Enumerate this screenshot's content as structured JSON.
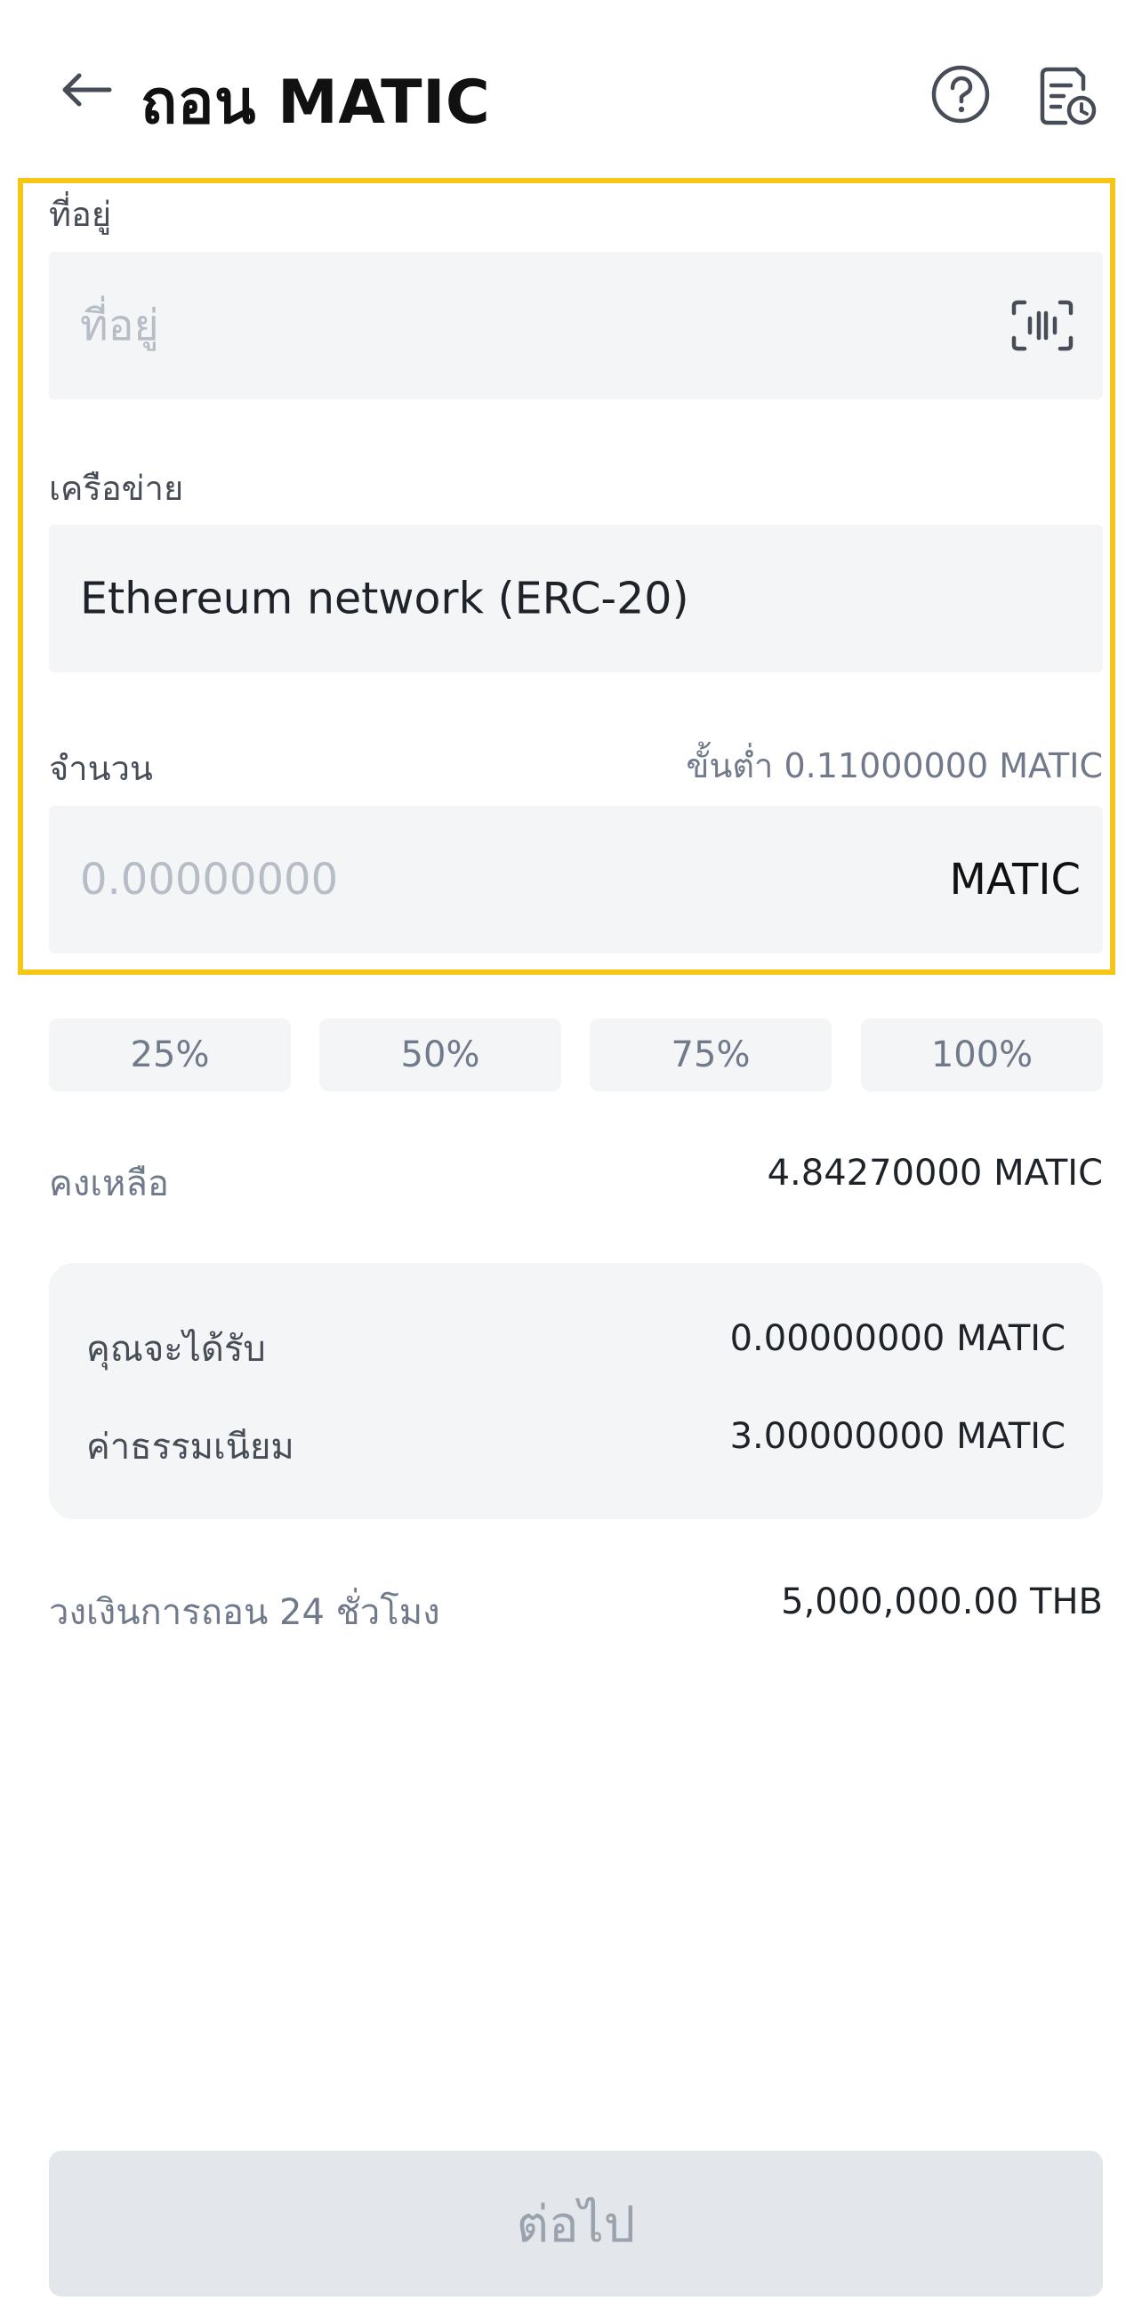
{
  "header": {
    "title": "ถอน MATIC",
    "back_icon": "arrow-left-icon",
    "help_icon": "question-circle-icon",
    "history_icon": "document-clock-icon"
  },
  "form": {
    "address": {
      "label": "ที่อยู่",
      "placeholder": "ที่อยู่",
      "scan_icon": "scan-icon"
    },
    "network": {
      "label": "เครือข่าย",
      "value": "Ethereum network (ERC-20)"
    },
    "amount": {
      "label": "จำนวน",
      "minimum": "ขั้นต่ำ 0.11000000 MATIC",
      "placeholder": "0.00000000",
      "unit": "MATIC"
    }
  },
  "percent_buttons": [
    "25%",
    "50%",
    "75%",
    "100%"
  ],
  "balance": {
    "label": "คงเหลือ",
    "value": "4.84270000 MATIC"
  },
  "summary": {
    "receive_label": "คุณจะได้รับ",
    "receive_value": "0.00000000 MATIC",
    "fee_label": "ค่าธรรมเนียม",
    "fee_value": "3.00000000 MATIC"
  },
  "limit": {
    "label": "วงเงินการถอน 24 ชั่วโมง",
    "value": "5,000,000.00 THB"
  },
  "continue_label": "ต่อไป",
  "colors": {
    "highlight": "#f5c518",
    "field_bg": "#f4f5f7",
    "button_disabled_bg": "#e3e6ea"
  }
}
